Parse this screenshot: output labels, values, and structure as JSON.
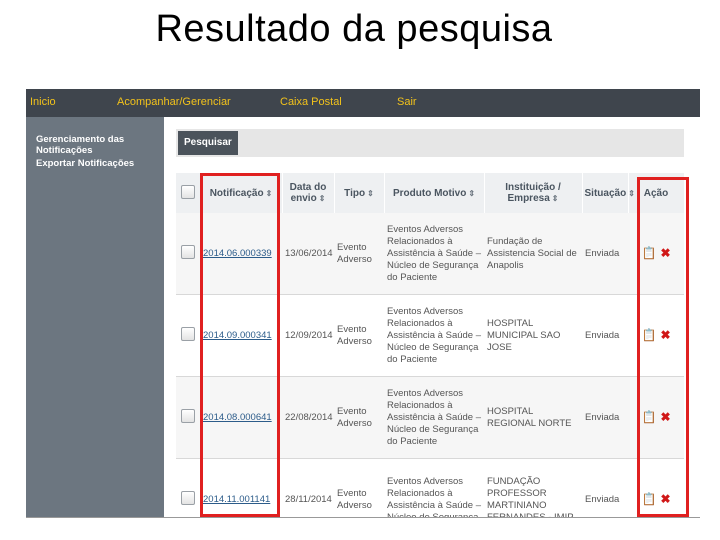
{
  "slide": {
    "title": "Resultado da pesquisa"
  },
  "nav": {
    "items": [
      "Inicio",
      "Acompanhar/Gerenciar",
      "Caixa Postal",
      "Sair"
    ]
  },
  "sidebar": {
    "items": [
      "Gerenciamento das Notificações",
      "Exportar Notificações"
    ]
  },
  "search": {
    "button_label": "Pesquisar"
  },
  "table": {
    "columns": [
      "Notificação",
      "Data do envio",
      "Tipo",
      "Produto Motivo",
      "Instituição / Empresa",
      "Situação",
      "Ação"
    ],
    "rows": [
      {
        "notificacao": "2014.06.000339",
        "data": "13/06/2014",
        "tipo": "Evento Adverso",
        "produto": "Eventos Adversos Relacionados à Assistência à Saúde – Núcleo de Segurança do Paciente",
        "instituicao": "Fundação de Assistencia Social de Anapolis",
        "situacao": "Enviada"
      },
      {
        "notificacao": "2014.09.000341",
        "data": "12/09/2014",
        "tipo": "Evento Adverso",
        "produto": "Eventos Adversos Relacionados à Assistência à Saúde – Núcleo de Segurança do Paciente",
        "instituicao": "HOSPITAL MUNICIPAL SAO JOSE",
        "situacao": "Enviada"
      },
      {
        "notificacao": "2014.08.000641",
        "data": "22/08/2014",
        "tipo": "Evento Adverso",
        "produto": "Eventos Adversos Relacionados à Assistência à Saúde – Núcleo de Segurança do Paciente",
        "instituicao": "HOSPITAL REGIONAL NORTE",
        "situacao": "Enviada"
      },
      {
        "notificacao": "2014.11.001141",
        "data": "28/11/2014",
        "tipo": "Evento Adverso",
        "produto": "Eventos Adversos Relacionados à Assistência à Saúde – Núcleo de Segurança",
        "instituicao": "FUNDAÇÃO PROFESSOR MARTINIANO FERNANDES - IMIP",
        "situacao": "Enviada"
      }
    ],
    "actions": {
      "view_icon": "clipboard-icon",
      "delete_icon": "delete-x-icon"
    }
  },
  "colors": {
    "nav_bg": "#3f454d",
    "nav_text": "#f2c21b",
    "sidebar_bg": "#6c7680",
    "highlight": "#e02020",
    "delete": "#d01818"
  }
}
